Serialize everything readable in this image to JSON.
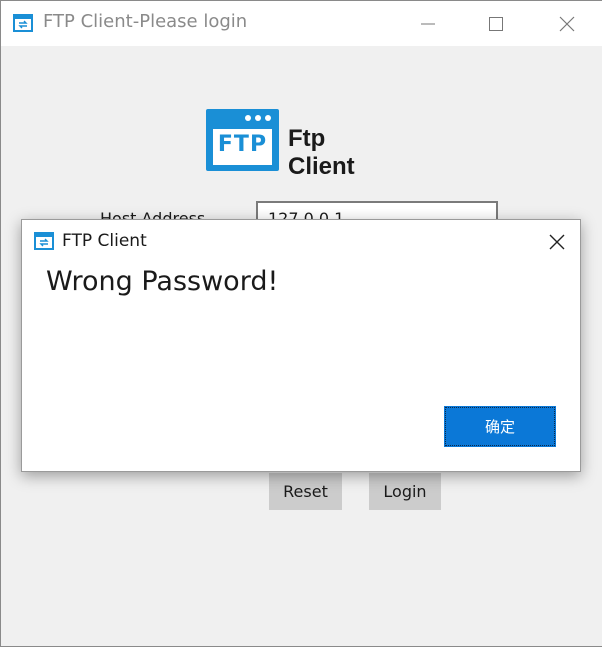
{
  "window": {
    "title": "FTP Client-Please login",
    "controls": [
      "minimize-icon",
      "maximize-icon",
      "close-icon"
    ]
  },
  "logo": {
    "badge_text": "FTP",
    "app_name": "Ftp Client"
  },
  "form": {
    "host_label": "Host Address",
    "host_value": "127.0.0.1"
  },
  "buttons": {
    "reset_label": "Reset",
    "login_label": "Login"
  },
  "dialog": {
    "title": "FTP Client",
    "message": "Wrong Password!",
    "ok_label": "确定"
  },
  "colors": {
    "accent": "#1a8fd6",
    "ok_button": "#0b78d7",
    "button_gray": "#cccccc"
  }
}
